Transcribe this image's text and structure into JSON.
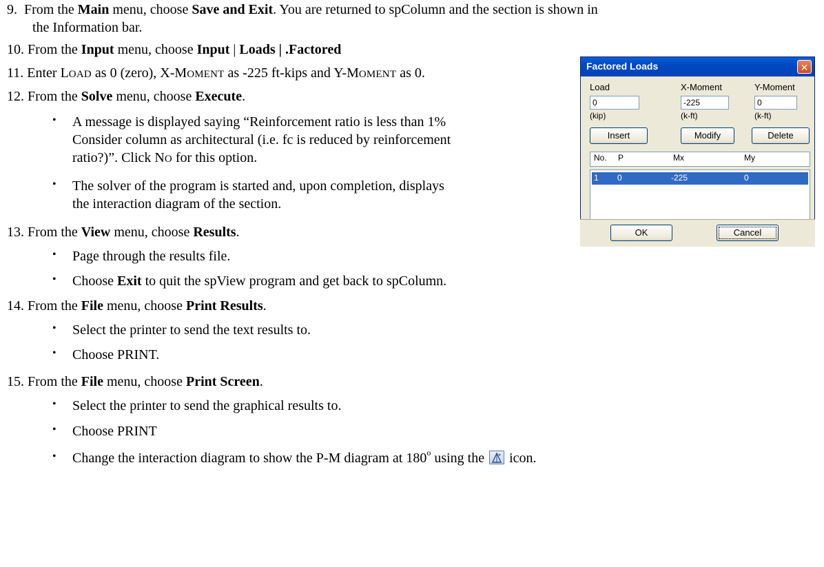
{
  "doc": {
    "s9_num": "9.",
    "s9_a": "From the ",
    "s9_b": "Main",
    "s9_c": " menu, choose ",
    "s9_d": "Save and Exit",
    "s9_e": ". You are returned to spColumn and the section is shown in",
    "s9_line2": "the Information bar.",
    "s10_num": "10.",
    "s10_a": "From the ",
    "s10_b": "Input",
    "s10_c": " menu, choose ",
    "s10_d": "Input",
    "s10_e": " | ",
    "s10_f": "Loads | .Factored",
    "s11_num": "11.",
    "s11_a": "Enter L",
    "s11_b": "OAD",
    "s11_c": " as 0 (zero), X-M",
    "s11_d": "OMENT",
    "s11_e": " as -225 ft-kips and Y-M",
    "s11_f": "OMENT",
    "s11_g": " as 0.",
    "s12_num": "12.",
    "s12_a": "From the ",
    "s12_b": "Solve",
    "s12_c": " menu, choose ",
    "s12_d": "Execute",
    "s12_e": ".",
    "b1_l1": "A message is displayed saying “Reinforcement ratio is less than 1%",
    "b1_l2": "Consider column as architectural (i.e. fc is reduced by reinforcement",
    "b1_l3a": "ratio?)”. Click N",
    "b1_l3b": "O",
    "b1_l3c": " for this option.",
    "b2_l1": "The solver of the program is started and, upon completion, displays",
    "b2_l2": "the interaction diagram of the section.",
    "s13_num": "13.",
    "s13_a": "From the ",
    "s13_b": "View",
    "s13_c": " menu, choose ",
    "s13_d": "Results",
    "s13_e": ".",
    "b3": "Page through the results file.",
    "b4_a": "Choose ",
    "b4_b": "Exit",
    "b4_c": " to quit the spView program and get back to spColumn.",
    "s14_num": "14.",
    "s14_a": "From the ",
    "s14_b": "File",
    "s14_c": " menu, choose ",
    "s14_d": "Print Results",
    "s14_e": ".",
    "b5": "Select the printer to send the text results to.",
    "b6": "Choose PRINT.",
    "s15_num": "15.",
    "s15_a": "From the ",
    "s15_b": "File",
    "s15_c": " menu, choose ",
    "s15_d": "Print Screen",
    "s15_e": ".",
    "b7": "Select the printer to send the graphical results to.",
    "b8": "Choose PRINT",
    "b9_a": "Change the interaction diagram to show the P-M diagram at 180",
    "b9_sup": "o",
    "b9_b": " using the ",
    "b9_c": " icon.",
    "bullet": "•"
  },
  "dialog": {
    "title": "Factored Loads",
    "close_glyph": "✕",
    "load_label": "Load",
    "xmoment_label": "X-Moment",
    "ymoment_label": "Y-Moment",
    "load_value": "0",
    "xmoment_value": "-225",
    "ymoment_value": "0",
    "load_unit": "(kip)",
    "xmoment_unit": "(k-ft)",
    "ymoment_unit": "(k-ft)",
    "insert_label": "Insert",
    "modify_label": "Modify",
    "delete_label": "Delete",
    "col_no": "No.",
    "col_p": "P",
    "col_mx": "Mx",
    "col_my": "My",
    "row": {
      "no": "1",
      "p": "0",
      "mx": "-225",
      "my": "0"
    },
    "ok_label": "OK",
    "cancel_label": "Cancel"
  },
  "icons": {
    "diagram_rotate": "pm-diagram-icon"
  }
}
